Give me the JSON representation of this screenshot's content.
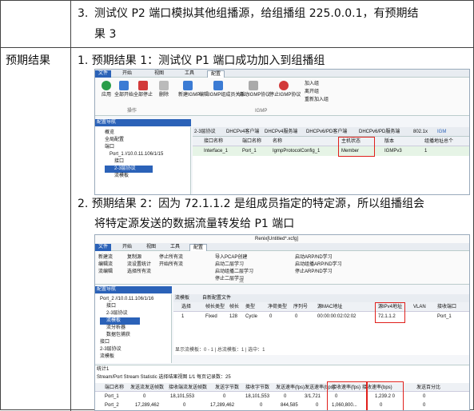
{
  "row1": {
    "number": "3.",
    "line1": "测试仪 P2 端口模拟其他组播源，给组播组 225.0.0.1，有预期结",
    "line2": "果 3"
  },
  "row2": {
    "label": "预期结果",
    "item1": "1.  预期结果 1：测试仪 P1 端口成功加入到组播组",
    "item2_line1": "2.  预期结果 2：因为 72.1.1.2 是组成员指定的特定源，所以组播组会",
    "item2_line2": "将特定源发送的数据流量转发给 P1 端口"
  },
  "ss1": {
    "tabs": [
      "文件",
      "开始",
      "视图",
      "工具",
      "配置"
    ],
    "buttons": [
      "应用",
      "全部开始",
      "全部停止",
      "删除",
      "新建IGMP",
      "编辑IGMP组成员关系",
      "启动IGMP协议",
      "停止IGMP协议"
    ],
    "right_items": [
      "加入组",
      "离开组",
      "重新加入组"
    ],
    "group_ops": "操作",
    "group_igmp": "IGMP",
    "nav_title": "配置导航",
    "nav_items": [
      "概览",
      "全局配置",
      "端口",
      "Port_1 //10.0.11.106/1/15",
      "接口",
      "2-3层协议",
      "流模板"
    ],
    "proto_tabs": [
      "2-3层协议",
      "DHCPv4客户端",
      "DHCPv4服务端",
      "DHCPv6/PD客户端",
      "DHCPv6/PD服务端",
      "802.1x",
      "IGM"
    ],
    "columns": [
      "接口名称",
      "端口名称",
      "名称",
      "主机状态",
      "版本",
      "组播地址总个"
    ],
    "row": [
      "Interface_1",
      "Port_1",
      "IgmpProtocolConfig_1",
      "Member",
      "IGMPv3",
      "1"
    ]
  },
  "ss2": {
    "title": "Renix[Untitled*.xcfg]",
    "tabs": [
      "文件",
      "开始",
      "视图",
      "工具",
      "配置"
    ],
    "ribbon_left": [
      "新建流",
      "编辑流",
      "流编辑",
      "复制源",
      "流设置统计",
      "选择所有流",
      "停止所有流",
      "开始所有流"
    ],
    "ribbon_right": [
      "导入PCAP创建",
      "启动二层学习",
      "启动组播二层学习",
      "停止二层学习",
      "启动ARP/ND学习",
      "启动组播ARP/ND学习",
      "停止ARP/ND学习"
    ],
    "group": "流",
    "nav_title": "配置导航",
    "nav_items": [
      "Port_2 //10.0.11.106/1/16",
      "接口",
      "2-3层协议",
      "流模板",
      "流分析器",
      "数据包捕获",
      "接口",
      "2-3层协议",
      "流模板"
    ],
    "tabs2": [
      "流模板",
      "自新配置文件"
    ],
    "columns": [
      "选择",
      "帧长类型",
      "帧长",
      "类型",
      "净荷类型",
      "序列号",
      "源MAC地址",
      "源IPv4地址",
      "VLAN",
      "接收端口"
    ],
    "row": [
      "1",
      "Fixed",
      "128",
      "Cycle",
      "0",
      "0",
      "00:00:00:02:02:02",
      "72.1.1.2",
      "",
      "Port_1"
    ],
    "status": "显示流模板：0 - 1 | 总流模板：1 | 选中：1",
    "stats_title": "统计1",
    "stats_toolbar": "Stream/Port Stream Statistic  选择结果视图  1/1  每页记录数：25",
    "stats_columns": [
      "端口名称",
      "发送流发送帧数",
      "接收端流发送帧数",
      "发送字节数",
      "接收字节数",
      "发送速率(fps)",
      "发送速率(bps)",
      "接收速率(fps)",
      "接收速率(bps)",
      "发送百分比"
    ],
    "stats_rows": [
      [
        "Port_1",
        "0",
        "18,101,553",
        "0",
        "18,101,553",
        "0",
        "3/1,721",
        "0",
        "1,239.2 0",
        "0"
      ],
      [
        "Port_2",
        "17,289,462",
        "0",
        "17,289,462",
        "0",
        "844,585",
        "0",
        "1,060,800...",
        "0",
        "0"
      ]
    ]
  }
}
